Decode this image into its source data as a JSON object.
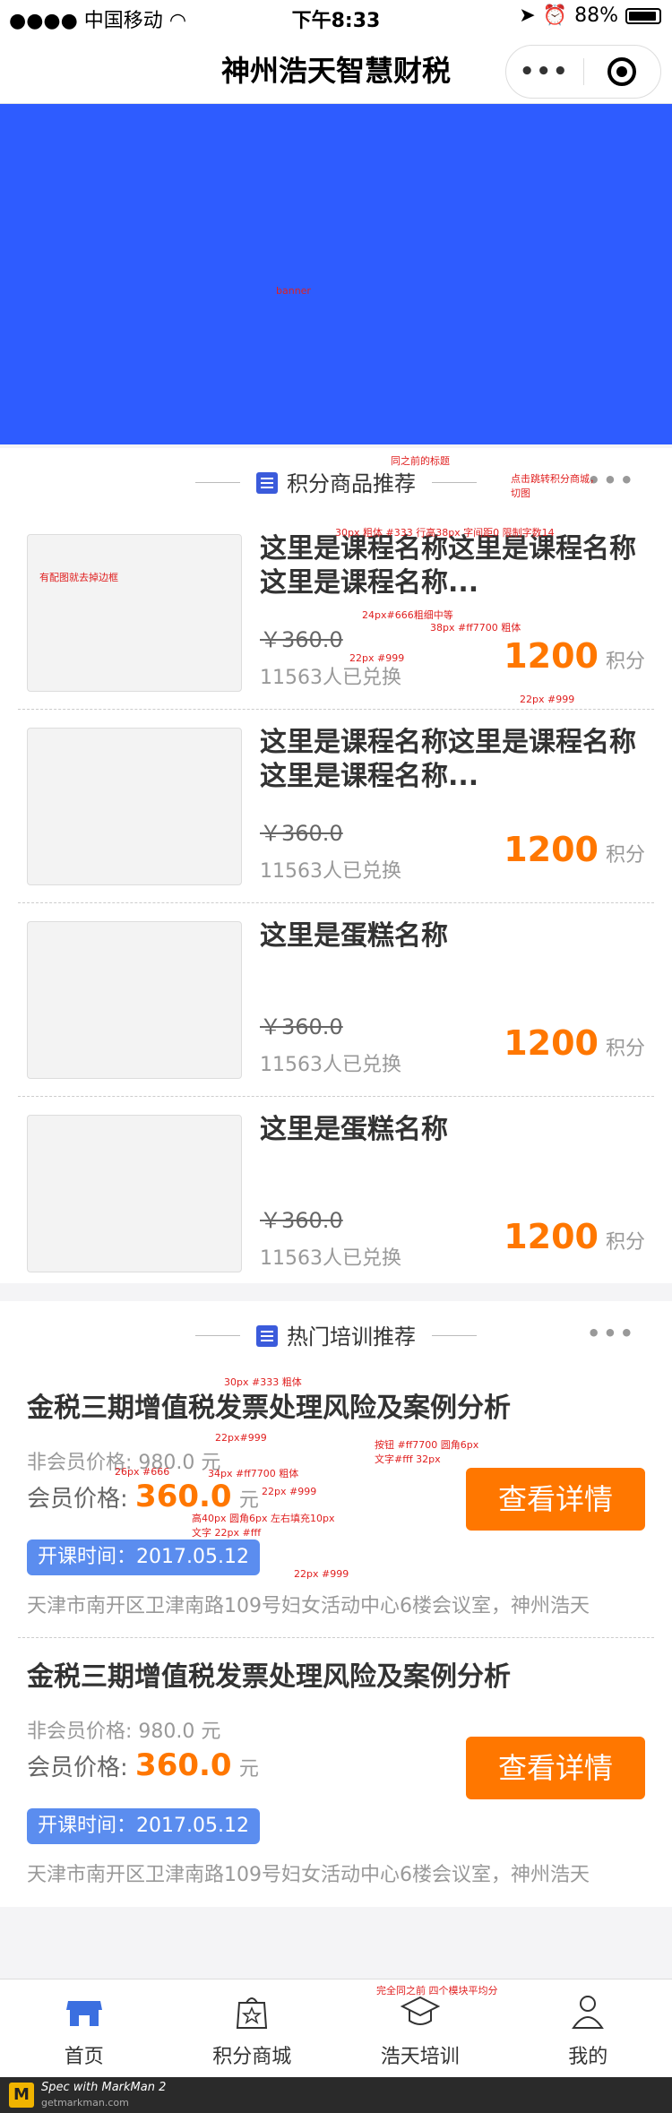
{
  "status": {
    "carrier": "中国移动",
    "time": "下午8:33",
    "battery": "88%"
  },
  "nav": {
    "title": "神州浩天智慧财税",
    "more_glyph": "•••"
  },
  "banner": {
    "label": "banner"
  },
  "points_section": {
    "title": "积分商品推荐",
    "note_title": "同之前的标题",
    "note_more": "点击跳转积分商城，切图",
    "more_glyph": "•••"
  },
  "products": [
    {
      "name": "这里是课程名称这里是课程名称这里是课程名称...",
      "old_price": "￥360.0",
      "sold": "11563人已兑换",
      "points": "1200",
      "unit": "积分"
    },
    {
      "name": "这里是课程名称这里是课程名称这里是课程名称...",
      "old_price": "￥360.0",
      "sold": "11563人已兑换",
      "points": "1200",
      "unit": "积分"
    },
    {
      "name": "这里是蛋糕名称",
      "old_price": "￥360.0",
      "sold": "11563人已兑换",
      "points": "1200",
      "unit": "积分"
    },
    {
      "name": "这里是蛋糕名称",
      "old_price": "￥360.0",
      "sold": "11563人已兑换",
      "points": "1200",
      "unit": "积分"
    }
  ],
  "product_notes": {
    "thumb": "有配图就去掉边框",
    "name_spec": "30px 粗体 #333 行高38px 字间距0 限制字数14",
    "old_price_spec": "24px#666粗细中等",
    "points_spec": "38px #ff7700 粗体",
    "sold_spec": "22px #999",
    "unit_spec": "22px #999"
  },
  "training_section": {
    "title": "热门培训推荐",
    "more_glyph": "•••"
  },
  "courses": [
    {
      "title": "金税三期增值税发票处理风险及案例分析",
      "nonmember": "非会员价格: 980.0 元",
      "member_label": "会员价格:",
      "member_price": "360.0",
      "member_unit": "元",
      "date": "开课时间：2017.05.12",
      "address": "天津市南开区卫津南路109号妇女活动中心6楼会议室，神州浩天",
      "button": "查看详情"
    },
    {
      "title": "金税三期增值税发票处理风险及案例分析",
      "nonmember": "非会员价格: 980.0 元",
      "member_label": "会员价格:",
      "member_price": "360.0",
      "member_unit": "元",
      "date": "开课时间：2017.05.12",
      "address": "天津市南开区卫津南路109号妇女活动中心6楼会议室，神州浩天",
      "button": "查看详情"
    }
  ],
  "course_notes": {
    "title_spec": "30px #333 粗体",
    "nonmember_spec": "22px#999",
    "member_label_spec": "26px #666",
    "price_spec": "34px #ff7700 粗体",
    "unit_spec": "22px #999",
    "badge_spec": "高40px 圆角6px 左右填充10px 文字 22px #fff",
    "address_spec": "22px #999",
    "button_spec": "按钮 #ff7700 圆角6px 文字#fff 32px"
  },
  "tabbar_note": "完全同之前 四个模块平均分",
  "tabs": [
    {
      "label": "首页",
      "icon": "home-store-icon"
    },
    {
      "label": "积分商城",
      "icon": "star-bag-icon"
    },
    {
      "label": "浩天培训",
      "icon": "graduation-cap-icon"
    },
    {
      "label": "我的",
      "icon": "user-icon"
    }
  ],
  "markman": {
    "line1": "Spec with MarkMan 2",
    "line2": "getmarkman.com"
  },
  "colors": {
    "banner": "#2e5cff",
    "accent": "#ff7700",
    "badge": "#5b8def"
  }
}
